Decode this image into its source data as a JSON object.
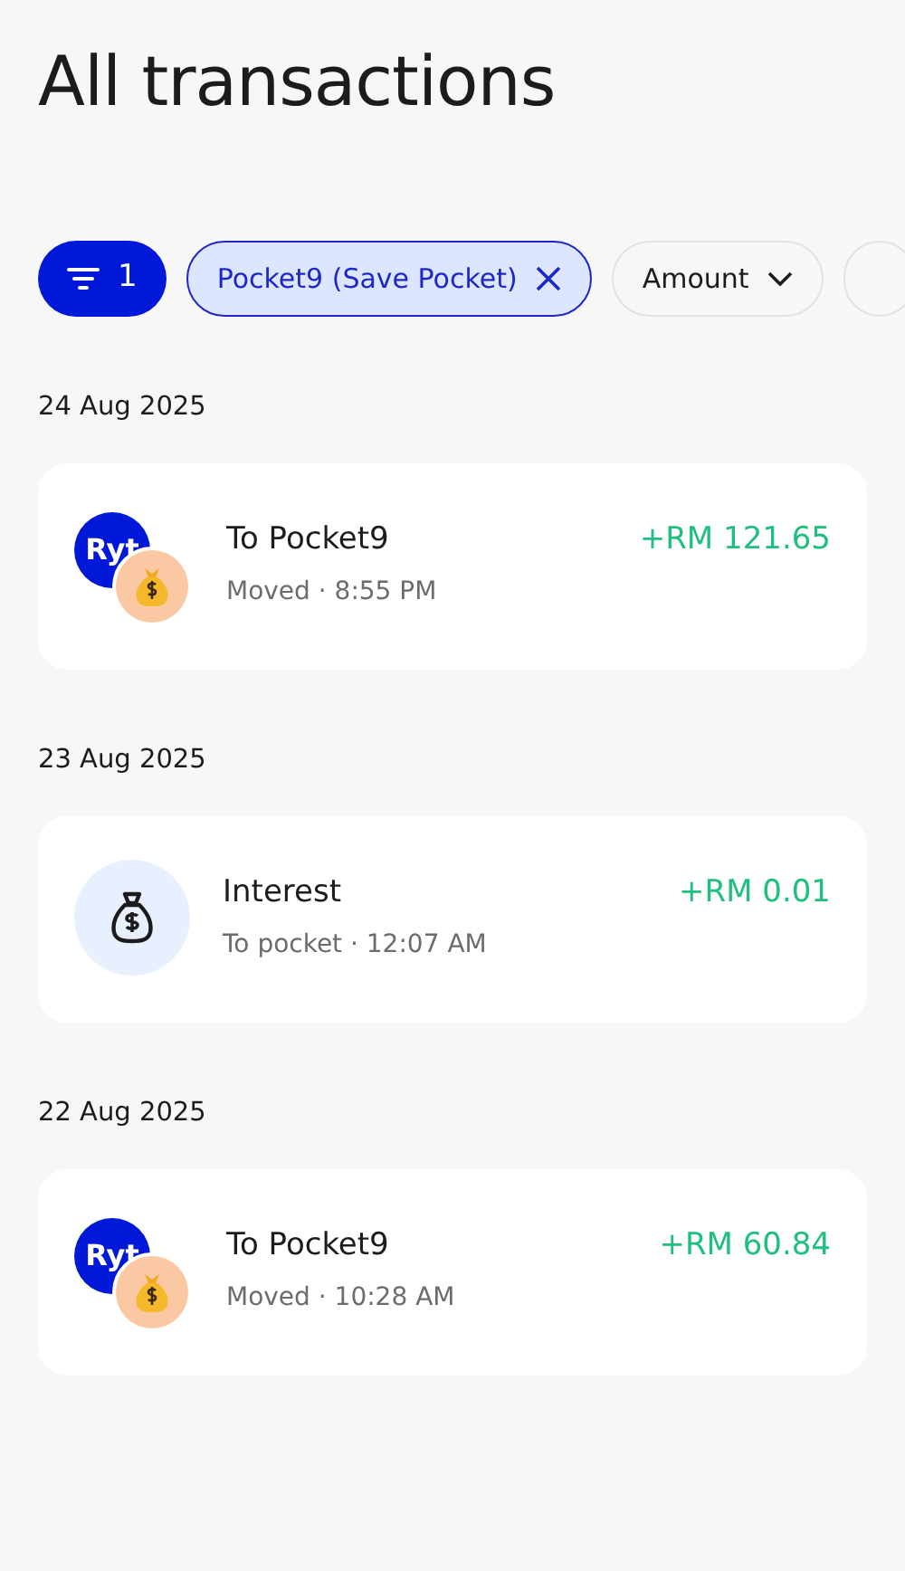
{
  "title": "All transactions",
  "filter_button": {
    "count": "1"
  },
  "chips": [
    {
      "kind": "removable",
      "label": "Pocket9 (Save Pocket)",
      "selected": true
    },
    {
      "kind": "dropdown",
      "label": "Amount",
      "selected": false
    },
    {
      "kind": "dropdown",
      "selected": false
    }
  ],
  "groups": [
    {
      "date": "24 Aug 2025",
      "transactions": [
        {
          "kind": "transfer",
          "logo_text": "Ryt",
          "title": "To Pocket9",
          "subtitle": "Moved · 8:55 PM",
          "amount": "+RM 121.65"
        }
      ]
    },
    {
      "date": "23 Aug 2025",
      "transactions": [
        {
          "kind": "interest",
          "title": "Interest",
          "subtitle": "To pocket · 12:07 AM",
          "amount": "+RM 0.01"
        }
      ]
    },
    {
      "date": "22 Aug 2025",
      "transactions": [
        {
          "kind": "transfer",
          "logo_text": "Ryt",
          "title": "To Pocket9",
          "subtitle": "Moved · 10:28 AM",
          "amount": "+RM 60.84"
        }
      ]
    }
  ]
}
